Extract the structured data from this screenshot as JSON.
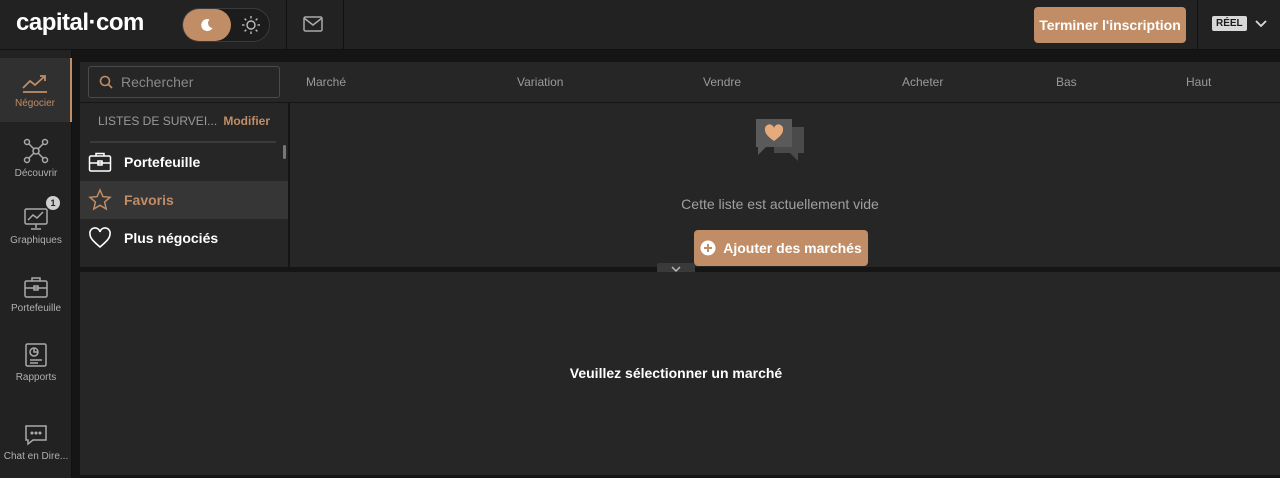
{
  "brand": {
    "logo_text": "capital·com",
    "accent": "#c08d66"
  },
  "topbar": {
    "theme_toggle": {
      "selected": "dark",
      "icons": [
        "moon-icon",
        "sun-icon"
      ]
    },
    "mail_icon": "mail-icon",
    "cta_label": "Terminer l'inscription",
    "account_badge": "RÉEL",
    "account_chevron": "chevron-down-icon"
  },
  "sidebar": {
    "items": [
      {
        "label": "Négocier",
        "icon": "trade-chart-icon",
        "active": true
      },
      {
        "label": "Découvrir",
        "icon": "network-icon"
      },
      {
        "label": "Graphiques",
        "icon": "monitor-chart-icon",
        "badge": "1"
      },
      {
        "label": "Portefeuille",
        "icon": "briefcase-icon"
      },
      {
        "label": "Rapports",
        "icon": "report-icon"
      },
      {
        "label": "Chat en Dire...",
        "icon": "chat-icon"
      }
    ]
  },
  "search": {
    "placeholder": "Rechercher"
  },
  "table": {
    "columns": [
      "Marché",
      "Variation",
      "Vendre",
      "Acheter",
      "Bas",
      "Haut"
    ]
  },
  "watchlists": {
    "header": "LISTES DE SURVEI...",
    "edit_label": "Modifier",
    "items": [
      {
        "label": "Portefeuille",
        "icon": "briefcase-icon"
      },
      {
        "label": "Favoris",
        "icon": "star-icon",
        "active": true
      },
      {
        "label": "Plus négociés",
        "icon": "heart-icon"
      }
    ]
  },
  "empty_state": {
    "icon": "heart-chat-icon",
    "message": "Cette liste est actuellement vide",
    "add_label": "Ajouter des marchés"
  },
  "bottom": {
    "message": "Veuillez sélectionner un marché"
  }
}
